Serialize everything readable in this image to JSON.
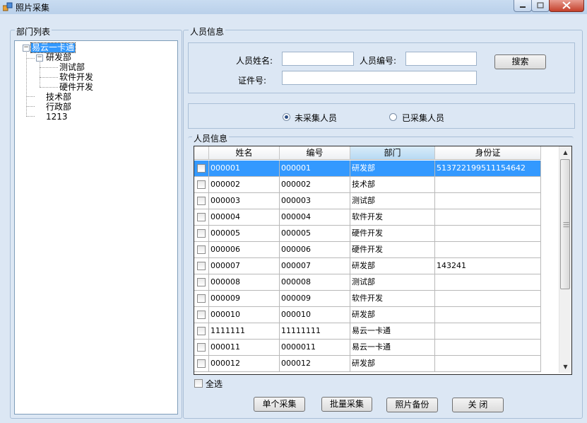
{
  "window": {
    "title": "照片采集"
  },
  "dept_panel": {
    "label": "部门列表",
    "tree": {
      "root": "易云一卡通",
      "children": [
        {
          "label": "研发部",
          "children": [
            "测试部",
            "软件开发",
            "硬件开发"
          ]
        },
        {
          "label": "技术部"
        },
        {
          "label": "行政部"
        },
        {
          "label": "1213"
        }
      ]
    }
  },
  "person_panel": {
    "label": "人员信息",
    "name_label": "人员姓名:",
    "name_value": "",
    "id_label": "人员编号:",
    "id_value": "",
    "cert_label": "证件号:",
    "cert_value": "",
    "search_button": "搜索"
  },
  "filter": {
    "uncollected": "未采集人员",
    "collected": "已采集人员",
    "selected": "uncollected"
  },
  "grid": {
    "label": "人员信息",
    "columns": [
      "姓名",
      "编号",
      "部门",
      "身份证"
    ],
    "sorted_column": "部门",
    "rows": [
      {
        "name": "000001",
        "number": "000001",
        "dept": "研发部",
        "idcard": "513722199511154642",
        "selected": true
      },
      {
        "name": "000002",
        "number": "000002",
        "dept": "技术部",
        "idcard": ""
      },
      {
        "name": "000003",
        "number": "000003",
        "dept": "测试部",
        "idcard": ""
      },
      {
        "name": "000004",
        "number": "000004",
        "dept": "软件开发",
        "idcard": ""
      },
      {
        "name": "000005",
        "number": "000005",
        "dept": "硬件开发",
        "idcard": ""
      },
      {
        "name": "000006",
        "number": "000006",
        "dept": "硬件开发",
        "idcard": ""
      },
      {
        "name": "000007",
        "number": "000007",
        "dept": "研发部",
        "idcard": "143241"
      },
      {
        "name": "000008",
        "number": "000008",
        "dept": "测试部",
        "idcard": ""
      },
      {
        "name": "000009",
        "number": "000009",
        "dept": "软件开发",
        "idcard": ""
      },
      {
        "name": "000010",
        "number": "000010",
        "dept": "研发部",
        "idcard": ""
      },
      {
        "name": "1111111",
        "number": "11111111",
        "dept": "易云一卡通",
        "idcard": ""
      },
      {
        "name": "000011",
        "number": "0000011",
        "dept": "易云一卡通",
        "idcard": ""
      },
      {
        "name": "000012",
        "number": "000012",
        "dept": "研发部",
        "idcard": ""
      }
    ]
  },
  "select_all": "全选",
  "buttons": {
    "single_capture": "单个采集",
    "batch_capture": "批量采集",
    "photo_backup": "照片备份",
    "close": "关 闭"
  },
  "colors": {
    "selection": "#3399ff",
    "window_bg": "#dce7f4"
  }
}
